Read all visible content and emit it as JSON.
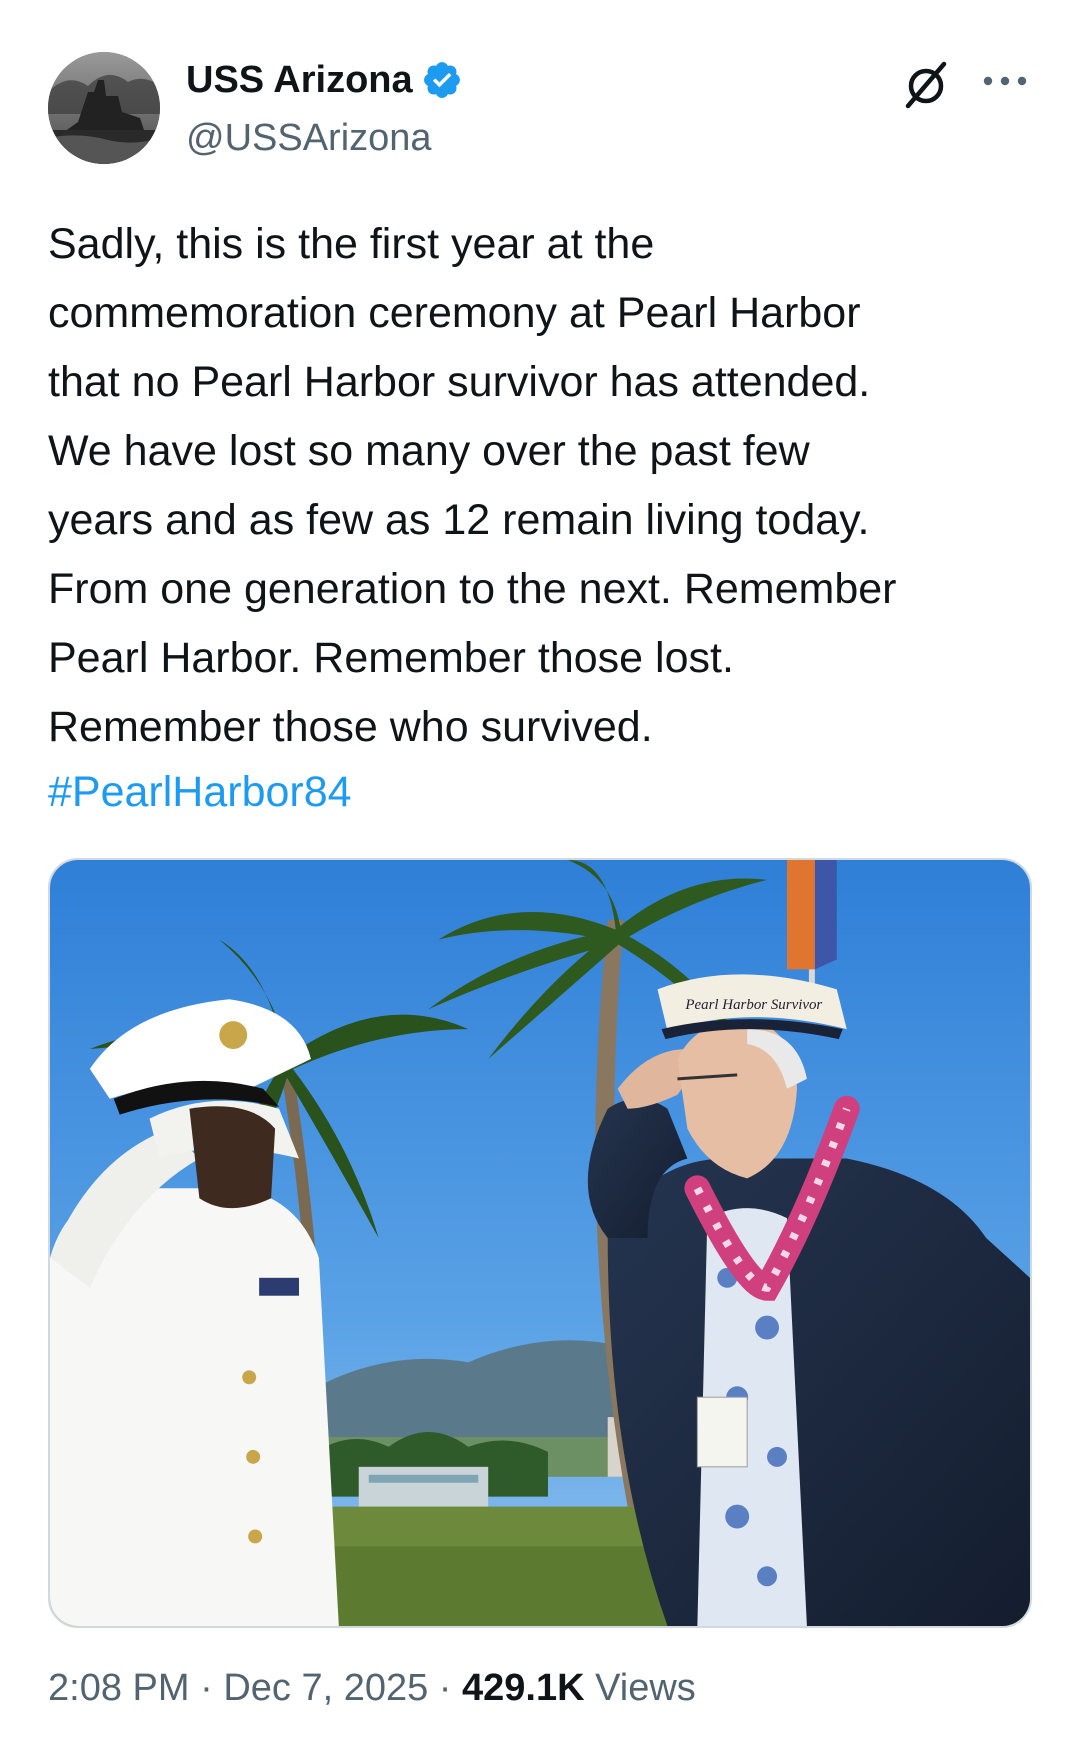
{
  "author": {
    "display_name": "USS Arizona",
    "handle": "@USSArizona",
    "avatar_icon": "battleship-photo-avatar",
    "verified_icon": "verified-badge-icon",
    "verified_color": "#1d9bf0"
  },
  "actions": {
    "grok_icon": "grok-slash-icon",
    "more_icon": "more-horizontal-icon"
  },
  "tweet": {
    "text": "Sadly, this is the first year at the\ncommemoration ceremony at Pearl Harbor\nthat no Pearl Harbor survivor has attended.\nWe have lost so many over the past few\nyears and as few as 12 remain living today.\nFrom one generation to the next. Remember\nPearl Harbor. Remember those lost.\nRemember those who survived.",
    "hashtag": "#PearlHarbor84",
    "hashtag_color": "#1d9bf0"
  },
  "media": {
    "subject": "photo-sailor-and-veteran-saluting",
    "hat_text": "Pearl Harbor Survivor"
  },
  "meta": {
    "time": "2:08 PM",
    "separator": "·",
    "date": "Dec 7, 2025",
    "views_count": "429.1K",
    "views_label": "Views"
  }
}
